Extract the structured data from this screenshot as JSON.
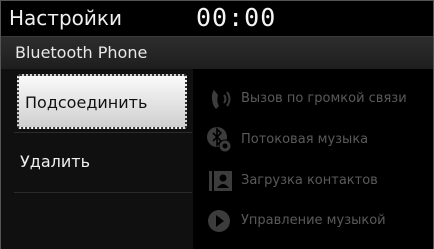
{
  "status": {
    "title": "Настройки",
    "clock": "00:00"
  },
  "header": {
    "subtitle": "Bluetooth Phone"
  },
  "menu": {
    "connect": "Подсоединить",
    "delete": "Удалить"
  },
  "options": [
    {
      "label": "Вызов по громкой связи",
      "icon": "handsfree-phone-icon"
    },
    {
      "label": "Потоковая музыка",
      "icon": "bluetooth-audio-icon"
    },
    {
      "label": "Загрузка контактов",
      "icon": "contacts-download-icon"
    },
    {
      "label": "Управление музыкой",
      "icon": "music-control-icon"
    }
  ],
  "colors": {
    "accent": "#ffffff",
    "disabled": "#5a5a5a",
    "background": "#000000"
  }
}
